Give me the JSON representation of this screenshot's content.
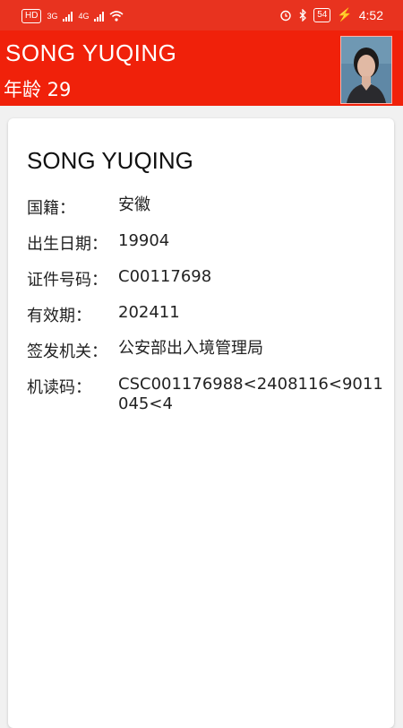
{
  "status_bar": {
    "left_badge": "HD",
    "sim1": "3G",
    "sim2": "4G",
    "battery": "54",
    "time": "4:52"
  },
  "header": {
    "name": "SONG YUQING",
    "age_text": "年龄 29"
  },
  "card": {
    "name": "SONG YUQING",
    "rows": [
      {
        "label": "国籍：",
        "value": "安徽"
      },
      {
        "label": "出生日期：",
        "value": "19904"
      },
      {
        "label": "证件号码：",
        "value": "C00117698"
      },
      {
        "label": "有效期：",
        "value": "202411"
      },
      {
        "label": "签发机关：",
        "value": "公安部出入境管理局"
      },
      {
        "label": "机读码：",
        "value": "CSC001176988<2408116<9011045<4"
      }
    ]
  }
}
